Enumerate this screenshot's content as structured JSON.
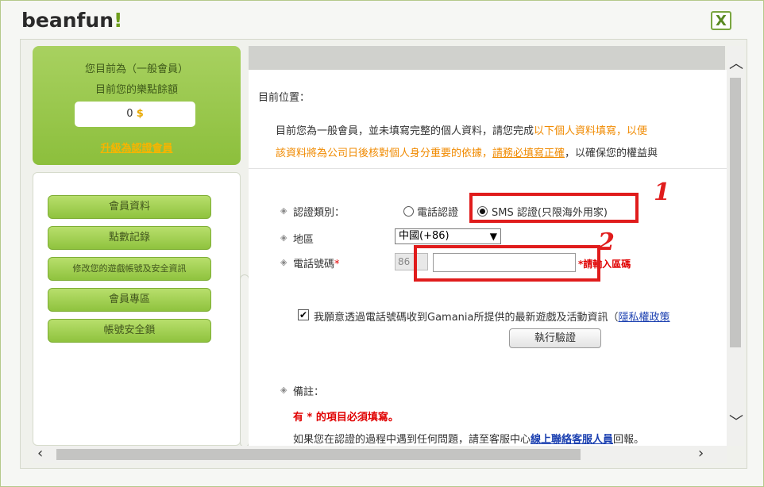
{
  "app": {
    "logo_main": "beanfun",
    "logo_accent": "!",
    "close_label": "X"
  },
  "member": {
    "type_line": "您目前為（一般會員）",
    "bonus_line": "目前您的樂點餘額",
    "points_value": "0",
    "points_icon": "coin-icon",
    "upgrade_link": "升級為認證會員"
  },
  "menu": {
    "items": [
      {
        "label": "會員資料"
      },
      {
        "label": "點數記錄"
      },
      {
        "label": "修改您的遊戲帳號及安全資訊"
      },
      {
        "label": "會員專區"
      },
      {
        "label": "帳號安全鎖"
      }
    ]
  },
  "content": {
    "location": "目前位置：",
    "intro_line1_a": "目前您為一般會員，並未填寫完整的個人資料，請您完成",
    "intro_line1_b": "以下個人資料填寫，以便",
    "intro_line2_a": "該資料將為公司日後核對個人身分重要的依據，",
    "intro_line2_b": "請務必填寫正確",
    "intro_line2_c": "，以確保您的權益與",
    "verify_type_label": "認證類別：",
    "option_phone": "電話認證",
    "option_sms": "SMS 認證(只限海外用家)",
    "region_label": "地區",
    "region_value": "中國(+86)",
    "phone_label": "電話號碼",
    "required_mark": "*",
    "phone_prefix": "86",
    "phone_value": "",
    "phone_hint": "*請輸入區碼",
    "consent_text": "我願意透過電話號碼收到Gamania所提供的最新遊戲及活動資訊（",
    "consent_link": "隱私權政策",
    "verify_button": "執行驗證",
    "notes_label": "備註：",
    "notes_required": "有 * 的項目必須填寫。",
    "notes_help_a": "如果您在認證的過程中遇到任何問題，請至客服中心",
    "notes_help_link": "線上聯絡客服人員",
    "notes_help_b": "回報。"
  },
  "annotations": {
    "label_1": "1",
    "label_2": "2",
    "color": "#e01c1c"
  },
  "colors": {
    "brand_green": "#8cbf3c",
    "accent_orange": "#f08a00",
    "required_red": "#e00000"
  }
}
